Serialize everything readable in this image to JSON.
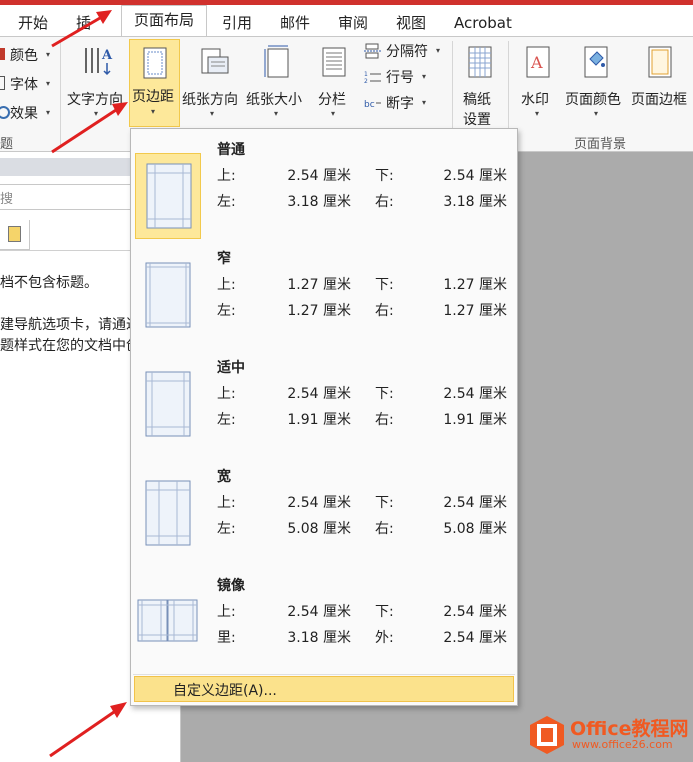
{
  "tabs": [
    {
      "label": "开始"
    },
    {
      "label": "插"
    },
    {
      "label": "页面布局"
    },
    {
      "label": "引用"
    },
    {
      "label": "邮件"
    },
    {
      "label": "审阅"
    },
    {
      "label": "视图"
    },
    {
      "label": "Acrobat"
    }
  ],
  "ribbon": {
    "theme": {
      "colors": "颜色",
      "fonts": "字体",
      "effects": "效果",
      "group_label": "题"
    },
    "text_direction": "文字方向",
    "margins": "页边距",
    "orientation": "纸张方向",
    "size": "纸张大小",
    "columns": "分栏",
    "breaks": "分隔符",
    "line_numbers": "行号",
    "hyphenation": "断字",
    "draft_line1": "稿纸",
    "draft_line2": "设置",
    "watermark": "水印",
    "page_color": "页面颜色",
    "page_border": "页面边框",
    "page_bg_group": "页面背景"
  },
  "left_pane": {
    "search_hint": "搜",
    "text1": "档不包含标题。",
    "text2": "建导航选项卡，请通过",
    "text3": "题样式在您的文档中创"
  },
  "margins_menu": {
    "options": [
      {
        "title": "普通",
        "l1": "上:",
        "v1": "2.54 厘米",
        "l2": "下:",
        "v2": "2.54 厘米",
        "l3": "左:",
        "v3": "3.18 厘米",
        "l4": "右:",
        "v4": "3.18 厘米"
      },
      {
        "title": "窄",
        "l1": "上:",
        "v1": "1.27 厘米",
        "l2": "下:",
        "v2": "1.27 厘米",
        "l3": "左:",
        "v3": "1.27 厘米",
        "l4": "右:",
        "v4": "1.27 厘米"
      },
      {
        "title": "适中",
        "l1": "上:",
        "v1": "2.54 厘米",
        "l2": "下:",
        "v2": "2.54 厘米",
        "l3": "左:",
        "v3": "1.91 厘米",
        "l4": "右:",
        "v4": "1.91 厘米"
      },
      {
        "title": "宽",
        "l1": "上:",
        "v1": "2.54 厘米",
        "l2": "下:",
        "v2": "2.54 厘米",
        "l3": "左:",
        "v3": "5.08 厘米",
        "l4": "右:",
        "v4": "5.08 厘米"
      },
      {
        "title": "镜像",
        "l1": "上:",
        "v1": "2.54 厘米",
        "l2": "下:",
        "v2": "2.54 厘米",
        "l3": "里:",
        "v3": "3.18 厘米",
        "l4": "外:",
        "v4": "2.54 厘米"
      }
    ],
    "custom": "自定义边距(A)..."
  },
  "watermark": {
    "brand": "Office教程网",
    "url": "www.office26.com"
  },
  "colors": {
    "accent_red": "#d0312d",
    "highlight": "#fde89a",
    "logo_orange": "#f05a22"
  }
}
